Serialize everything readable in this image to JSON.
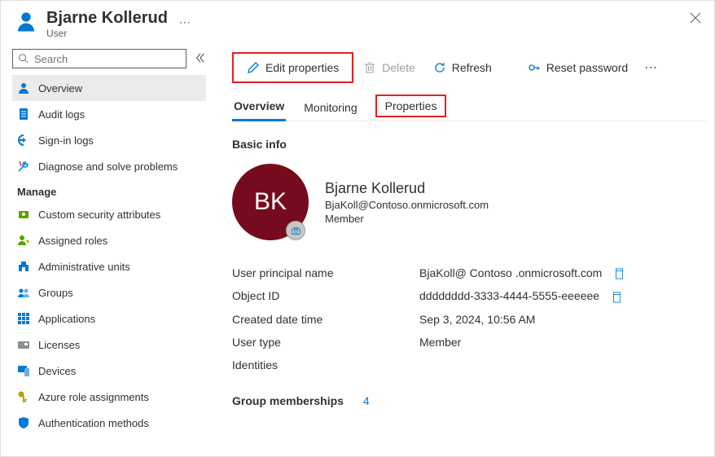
{
  "header": {
    "title": "Bjarne Kollerud",
    "subtitle": "User"
  },
  "search": {
    "placeholder": "Search"
  },
  "sidebar": {
    "items": [
      {
        "label": "Overview"
      },
      {
        "label": "Audit logs"
      },
      {
        "label": "Sign-in logs"
      },
      {
        "label": "Diagnose and solve problems"
      }
    ],
    "manage_header": "Manage",
    "manage_items": [
      {
        "label": "Custom security attributes"
      },
      {
        "label": "Assigned roles"
      },
      {
        "label": "Administrative units"
      },
      {
        "label": "Groups"
      },
      {
        "label": "Applications"
      },
      {
        "label": "Licenses"
      },
      {
        "label": "Devices"
      },
      {
        "label": "Azure role assignments"
      },
      {
        "label": "Authentication methods"
      }
    ]
  },
  "toolbar": {
    "edit": "Edit properties",
    "delete": "Delete",
    "refresh": "Refresh",
    "reset": "Reset password"
  },
  "tabs": {
    "overview": "Overview",
    "monitoring": "Monitoring",
    "properties": "Properties"
  },
  "section": {
    "basic_info": "Basic info"
  },
  "profile": {
    "initials": "BK",
    "name": "Bjarne Kollerud",
    "email": "BjaKoll@Contoso.onmicrosoft.com",
    "member": "Member"
  },
  "details": {
    "upn_label": "User principal name",
    "upn_value": "BjaKoll@ Contoso .onmicrosoft.com",
    "oid_label": "Object ID",
    "oid_value": "dddddddd-3333-4444-5555-eeeeee",
    "created_label": "Created date time",
    "created_value": "Sep 3, 2024, 10:56 AM",
    "utype_label": "User type",
    "utype_value": "Member",
    "identities_label": "Identities"
  },
  "groups": {
    "label": "Group memberships",
    "count": "4"
  }
}
